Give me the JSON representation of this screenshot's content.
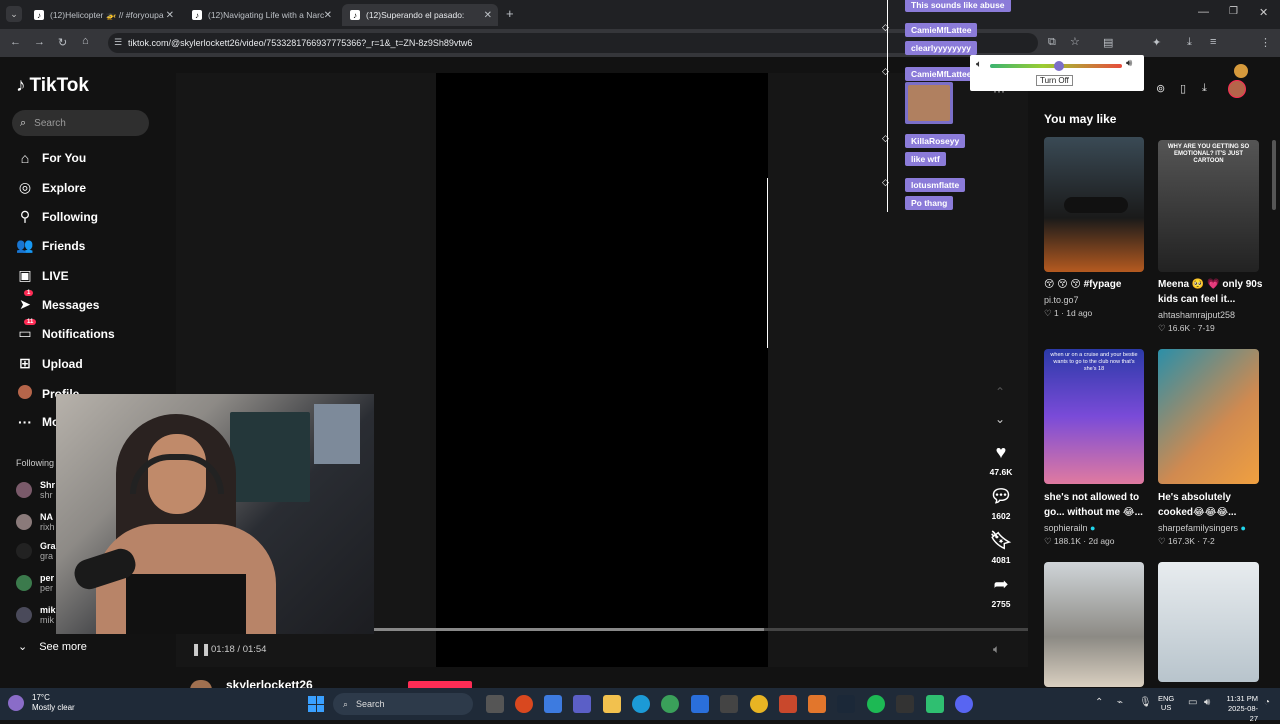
{
  "tabs": [
    {
      "title": "(12)Helicopter 🚁 // #foryoupa"
    },
    {
      "title": "(12)Navigating Life with a Narc"
    },
    {
      "title": "(12)Superando el pasado: "
    }
  ],
  "address": {
    "url": "tiktok.com/@skylerlockett26/video/7533281766937775366?_r=1&_t=ZN-8z9Sh89vtw6"
  },
  "brand": {
    "name": "TikTok"
  },
  "search": {
    "placeholder": "Search"
  },
  "nav": {
    "items": [
      {
        "label": "For You",
        "icon": "home-icon"
      },
      {
        "label": "Explore",
        "icon": "compass-icon"
      },
      {
        "label": "Following",
        "icon": "person-icon"
      },
      {
        "label": "Friends",
        "icon": "friends-icon"
      },
      {
        "label": "LIVE",
        "icon": "live-icon"
      },
      {
        "label": "Messages",
        "icon": "send-icon",
        "badge": "1"
      },
      {
        "label": "Notifications",
        "icon": "bell-icon",
        "badge": "11"
      },
      {
        "label": "Upload",
        "icon": "plus-box-icon"
      },
      {
        "label": "Profile",
        "icon": "avatar-icon"
      },
      {
        "label": "Mo",
        "icon": "more-icon"
      }
    ],
    "following_label": "Following",
    "following_accounts": [
      {
        "line1": "Shr",
        "line2": "shr"
      },
      {
        "line1": "NA",
        "line2": "rixh"
      },
      {
        "line1": "Gra",
        "line2": "gra"
      },
      {
        "line1": "per",
        "line2": "per"
      },
      {
        "line1": "mik",
        "line2": "mik"
      }
    ],
    "see_more": "See more"
  },
  "player": {
    "time": "01:18 / 01:54",
    "progress": 0.69,
    "author": "skylerlockett26"
  },
  "actions": {
    "likes": "47.6K",
    "comments": "1602",
    "saves": "4081",
    "shares": "2755"
  },
  "chat": {
    "messages": [
      {
        "name": "",
        "text": "This sounds like abuse"
      },
      {
        "name": "CamieMfLattee",
        "text": "clearlyyyyyyyy"
      },
      {
        "name": "CamieMfLattee",
        "text": ""
      },
      {
        "name": "KillaRoseyy",
        "text": "like wtf"
      },
      {
        "name": "lotusmflatte",
        "text": "Po thang"
      }
    ]
  },
  "volume_popup": {
    "turn_off": "Turn Off",
    "level": 0.52
  },
  "recommended": {
    "heading": "You may like",
    "cards": [
      {
        "title": "😚 😚 😚 #fypage",
        "author": "pi.to.go7",
        "likes": "1",
        "date": "1d ago"
      },
      {
        "title": "Meena 🥺 💗 only 90s kids can feel it...",
        "author": "ahtashamrajput258",
        "likes": "16.6K",
        "date": "7-19",
        "overlay": "WHY ARE YOU GETTING SO EMOTIONAL? IT'S JUST CARTOON"
      },
      {
        "title": "she's not allowed to go... without me 😂...",
        "author": "sophierailn",
        "likes": "188.1K",
        "date": "2d ago",
        "overlay": "when ur on a cruise and your bestie wants to go to the club now that's she's 18"
      },
      {
        "title": "He's absolutely cooked😂😂😂...",
        "author": "sharpefamilysingers",
        "likes": "167.3K",
        "date": "7-2"
      },
      {
        "title": "",
        "author": "",
        "likes": "",
        "date": ""
      },
      {
        "title": "",
        "author": "",
        "likes": "",
        "date": ""
      }
    ]
  },
  "taskbar": {
    "weather_temp": "17°C",
    "weather_desc": "Mostly clear",
    "search_label": "Search",
    "lang1": "ENG",
    "lang2": "US",
    "time": "11:31 PM",
    "date": "2025-08-27"
  }
}
